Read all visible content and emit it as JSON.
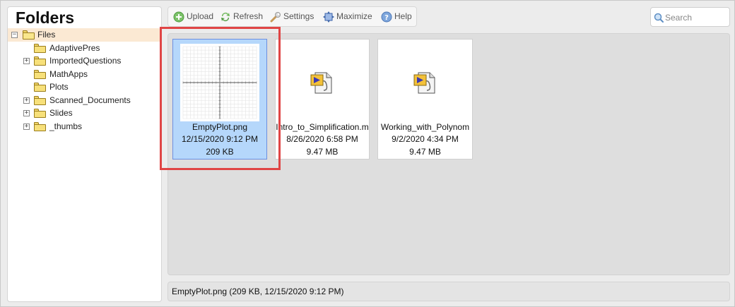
{
  "sidebar": {
    "title": "Folders",
    "root": {
      "label": "Files",
      "expander": "−"
    },
    "items": [
      {
        "label": "AdaptivePres",
        "expander": ""
      },
      {
        "label": "ImportedQuestions",
        "expander": "+"
      },
      {
        "label": "MathApps",
        "expander": ""
      },
      {
        "label": "Plots",
        "expander": ""
      },
      {
        "label": "Scanned_Documents",
        "expander": "+"
      },
      {
        "label": "Slides",
        "expander": "+"
      },
      {
        "label": "_thumbs",
        "expander": "+"
      }
    ]
  },
  "toolbar": {
    "upload": {
      "label": "Upload",
      "icon": "upload-icon"
    },
    "refresh": {
      "label": "Refresh",
      "icon": "refresh-icon"
    },
    "settings": {
      "label": "Settings",
      "icon": "wrench-icon"
    },
    "maximize": {
      "label": "Maximize",
      "icon": "maximize-icon"
    },
    "help": {
      "label": "Help",
      "icon": "help-icon"
    }
  },
  "search": {
    "placeholder": "Search",
    "value": ""
  },
  "files": [
    {
      "name": "EmptyPlot.png",
      "date": "12/15/2020 9:12 PM",
      "size": "209 KB",
      "selected": true,
      "thumbnail": "plot-thumbnail"
    },
    {
      "name": "Intro_to_Simplification.m",
      "date": "8/26/2020 6:58 PM",
      "size": "9.47 MB",
      "selected": false,
      "thumbnail": "maple-document-icon"
    },
    {
      "name": "Working_with_Polynom",
      "date": "9/2/2020 4:34 PM",
      "size": "9.47 MB",
      "selected": false,
      "thumbnail": "maple-document-icon"
    }
  ],
  "status": {
    "text": "EmptyPlot.png (209 KB, 12/15/2020 9:12 PM)"
  },
  "colors": {
    "selection": "#b5d7fb",
    "selection_border": "#6c8fe0",
    "highlight": "#e04545",
    "root_row": "#fbe9d3",
    "folder": "#f7e07a"
  }
}
